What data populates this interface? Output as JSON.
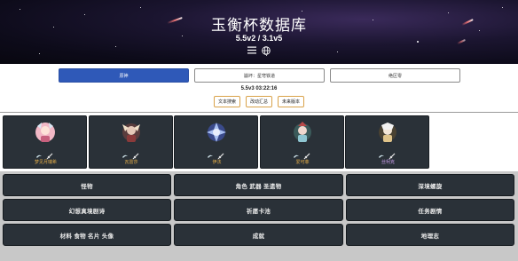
{
  "header": {
    "title": "玉衡杯数据库",
    "version": "5.5v2 / 3.1v5",
    "icons": [
      "menu-icon",
      "globe-icon"
    ]
  },
  "tabs": [
    {
      "label": "原神",
      "active": true
    },
    {
      "label": "崩坏：星穹铁道",
      "active": false
    },
    {
      "label": "绝区零",
      "active": false
    }
  ],
  "datetime": "5.5v3 03:22:16",
  "sub_buttons": [
    "文本搜索",
    "改动汇总",
    "未来版本"
  ],
  "characters": [
    {
      "name": "梦见月瑞希",
      "color": "#e8b04a",
      "icon": "character-portrait-icon"
    },
    {
      "name": "瓦雷莎",
      "color": "#e8b04a",
      "icon": "character-portrait-icon"
    },
    {
      "name": "伊法",
      "color": "#e8b04a",
      "icon": "character-portrait-icon"
    },
    {
      "name": "爱可菲",
      "color": "#e8b04a",
      "icon": "character-portrait-icon"
    },
    {
      "name": "丝柯克",
      "color": "#c79ce8",
      "icon": "character-portrait-icon"
    }
  ],
  "grid_buttons": [
    "怪物",
    "角色 武器 圣遗物",
    "深境螺旋",
    "幻想真境剧诗",
    "祈愿卡池",
    "任务剧情",
    "材料 食物 名片 头像",
    "成就",
    "地理志"
  ],
  "colors": {
    "accent": "#2f59b8",
    "card_bg": "#2a3138",
    "sub_button_border": "#d9a24a"
  }
}
